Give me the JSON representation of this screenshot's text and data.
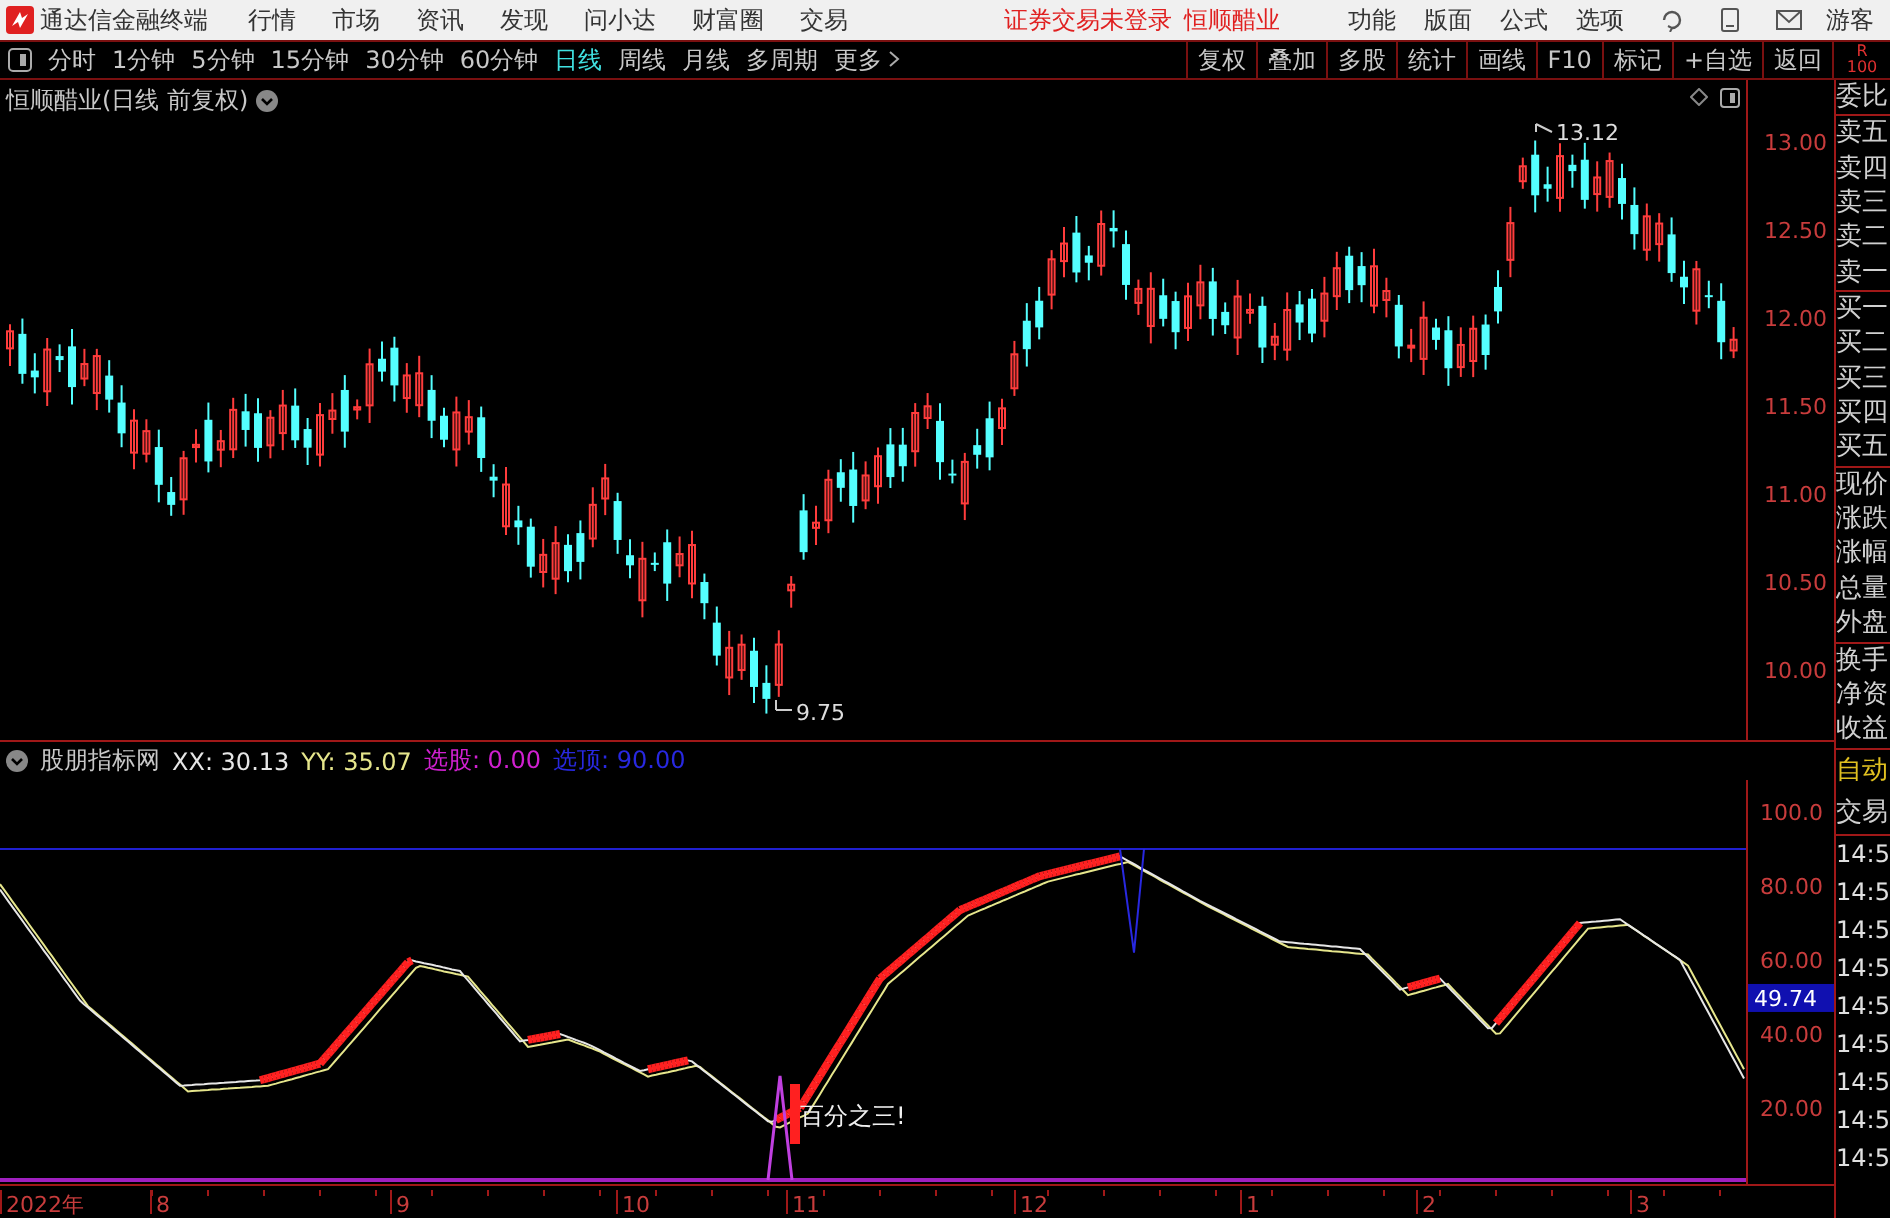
{
  "app": {
    "title": "通达信金融终端"
  },
  "menu": [
    "行情",
    "市场",
    "资讯",
    "发现",
    "问小达",
    "财富圈",
    "交易"
  ],
  "login_status": "证券交易未登录",
  "stock_top": "恒顺醋业",
  "menu_right": [
    "功能",
    "版面",
    "公式",
    "选项"
  ],
  "user": "游客",
  "periods": [
    {
      "label": "分时",
      "selected": false
    },
    {
      "label": "1分钟",
      "selected": false
    },
    {
      "label": "5分钟",
      "selected": false
    },
    {
      "label": "15分钟",
      "selected": false
    },
    {
      "label": "30分钟",
      "selected": false
    },
    {
      "label": "60分钟",
      "selected": false
    },
    {
      "label": "日线",
      "selected": true
    },
    {
      "label": "周线",
      "selected": false
    },
    {
      "label": "月线",
      "selected": false
    },
    {
      "label": "多周期",
      "selected": false
    }
  ],
  "more": "更多",
  "tools": [
    "复权",
    "叠加",
    "多股",
    "统计",
    "画线",
    "F10",
    "标记",
    "+自选",
    "返回"
  ],
  "side_header": {
    "line1": "R",
    "line2": "100"
  },
  "price_pane": {
    "title": "恒顺醋业(日线 前复权)",
    "y_ticks": [
      "13.00",
      "12.50",
      "12.00",
      "11.50",
      "11.00",
      "10.50",
      "10.00"
    ],
    "high_label": "13.12",
    "low_label": "9.75"
  },
  "indicator": {
    "name": "股朋指标网",
    "values": [
      {
        "text": "XX: 30.13",
        "color": "#e6e6e6"
      },
      {
        "text": "YY: 35.07",
        "color": "#e6e68c"
      },
      {
        "text": "选股: 0.00",
        "color": "#d020d0"
      },
      {
        "text": "选顶: 90.00",
        "color": "#2828e0"
      }
    ],
    "y_ticks": [
      "100.0",
      "80.00",
      "60.00",
      "40.00",
      "20.00"
    ],
    "current": "49.74",
    "note": "百分之三!"
  },
  "x_ticks": [
    "2022年",
    "8",
    "9",
    "10",
    "11",
    "12",
    "1",
    "2",
    "3"
  ],
  "quote_fields": [
    "委比",
    "卖五",
    "卖四",
    "卖三",
    "卖二",
    "卖一",
    "买一",
    "买二",
    "买三",
    "买四",
    "买五",
    "现价",
    "涨跌",
    "涨幅",
    "总量",
    "外盘",
    "换手",
    "净资",
    "收益"
  ],
  "auto_label": "自动",
  "trade_label": "交易",
  "trade_times": [
    "14:5",
    "14:5",
    "14:5",
    "14:5",
    "14:5",
    "14:5",
    "14:5",
    "14:5",
    "14:5"
  ]
}
